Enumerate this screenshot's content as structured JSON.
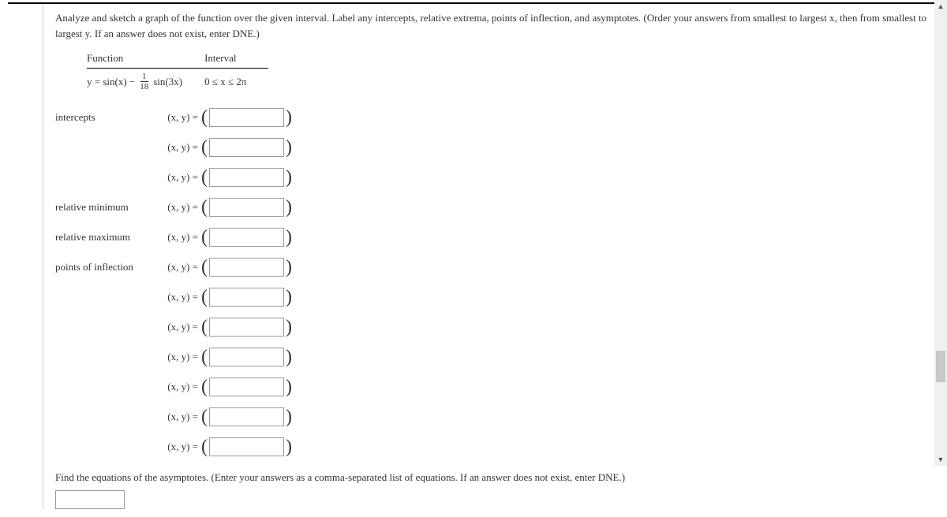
{
  "instructions": "Analyze and sketch a graph of the function over the given interval. Label any intercepts, relative extrema, points of inflection, and asymptotes. (Order your answers from smallest to largest x, then from smallest to largest y. If an answer does not exist, enter DNE.)",
  "table": {
    "function_header": "Function",
    "interval_header": "Interval",
    "func_prefix": "y = sin(x) − ",
    "frac_num": "1",
    "frac_den": "18",
    "func_suffix": " sin(3x)",
    "interval_value": "0 ≤ x ≤ 2π"
  },
  "xy_label": "(x, y) = ",
  "labels": {
    "intercepts": "intercepts",
    "rel_min": "relative minimum",
    "rel_max": "relative maximum",
    "inflection": "points of inflection"
  },
  "followup": "Find the equations of the asymptotes. (Enter your answers as a comma-separated list of equations. If an answer does not exist, enter DNE.)"
}
